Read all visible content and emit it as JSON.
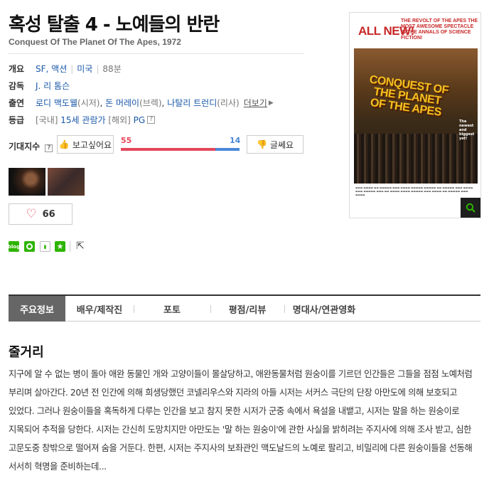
{
  "header": {
    "title": "혹성 탈출 4 - 노예들의 반란",
    "subtitle": "Conquest Of The Planet Of The Apes, 1972"
  },
  "overview": {
    "label": "개요",
    "genre": "SF, 액션",
    "country": "미국",
    "runtime": "88분"
  },
  "director": {
    "label": "감독",
    "name": "J. 리 톰슨"
  },
  "cast": {
    "label": "출연",
    "actors": [
      {
        "name": "로디 맥도웰",
        "role": "(시저)"
      },
      {
        "name": "돈 머레이",
        "role": "(브렉)"
      },
      {
        "name": "나탈리 트런디",
        "role": "(리사)"
      }
    ],
    "more": "더보기"
  },
  "rating": {
    "label": "등급",
    "domestic_tag": "[국내]",
    "domestic": "15세 관람가",
    "overseas_tag": "[해외]",
    "overseas": "PG",
    "help": "?"
  },
  "expectation": {
    "label": "기대지수",
    "help": "?",
    "want_label": "보고싶어요",
    "want_count": "55",
    "meh_label": "글쎄요",
    "meh_count": "14",
    "want_ratio": 0.797
  },
  "like": {
    "count": "66"
  },
  "share": {
    "blog": "blog"
  },
  "poster": {
    "headline": "ALL NEW!",
    "revolt": "THE REVOLT OF THE APES THE MOST AWESOME SPECTACLE IN THE ANNALS OF SCIENCE FICTION!",
    "art_title": "CONQUEST OF THE PLANET OF THE APES",
    "tagline": "The newest and biggest yet!"
  },
  "tabs": [
    {
      "label": "주요정보",
      "active": true
    },
    {
      "label": "배우/제작진",
      "active": false
    },
    {
      "label": "포토",
      "active": false
    },
    {
      "label": "평점/리뷰",
      "active": false
    },
    {
      "label": "명대사/연관영화",
      "active": false
    }
  ],
  "story": {
    "heading": "줄거리",
    "text": "지구에 알 수 없는 병이 돌아 애완 동물인 개와 고양이들이 몰살당하고, 애완동물처럼 원숭이를 기르던 인간들은 그들을 점점 노예처럼 부리며 살아간다. 20년 전 인간에 의해 희생당했던 코넬리우스와 지라의 아들 시저는 서커스 극단의 단장 아만도에 의해 보호되고 있었다. 그러나 원숭이들을 혹독하게 다루는 인간을 보고 참지 못한 시저가 군중 속에서 욕설을 내뱉고, 시저는 말을 하는 원숭이로 지목되어 추적을 당한다. 시저는 간신히 도망치지만 아만도는 '말 하는 원숭이'에 관한 사실을 밝히려는 주지사에 의해 조사 받고, 심한 고문도중 창밖으로 떨어져 숨을 거둔다. 한편, 시저는 주지사의 보좌관인 맥도날드의 노예로 팔리고, 비밀리에 다른 원숭이들을 선동해 서서히 혁명을 준비하는데..."
  },
  "colors": {
    "accent_red": "#e5475a",
    "accent_blue": "#4a88d8",
    "link": "#1a58a8",
    "active_tab": "#666666"
  }
}
